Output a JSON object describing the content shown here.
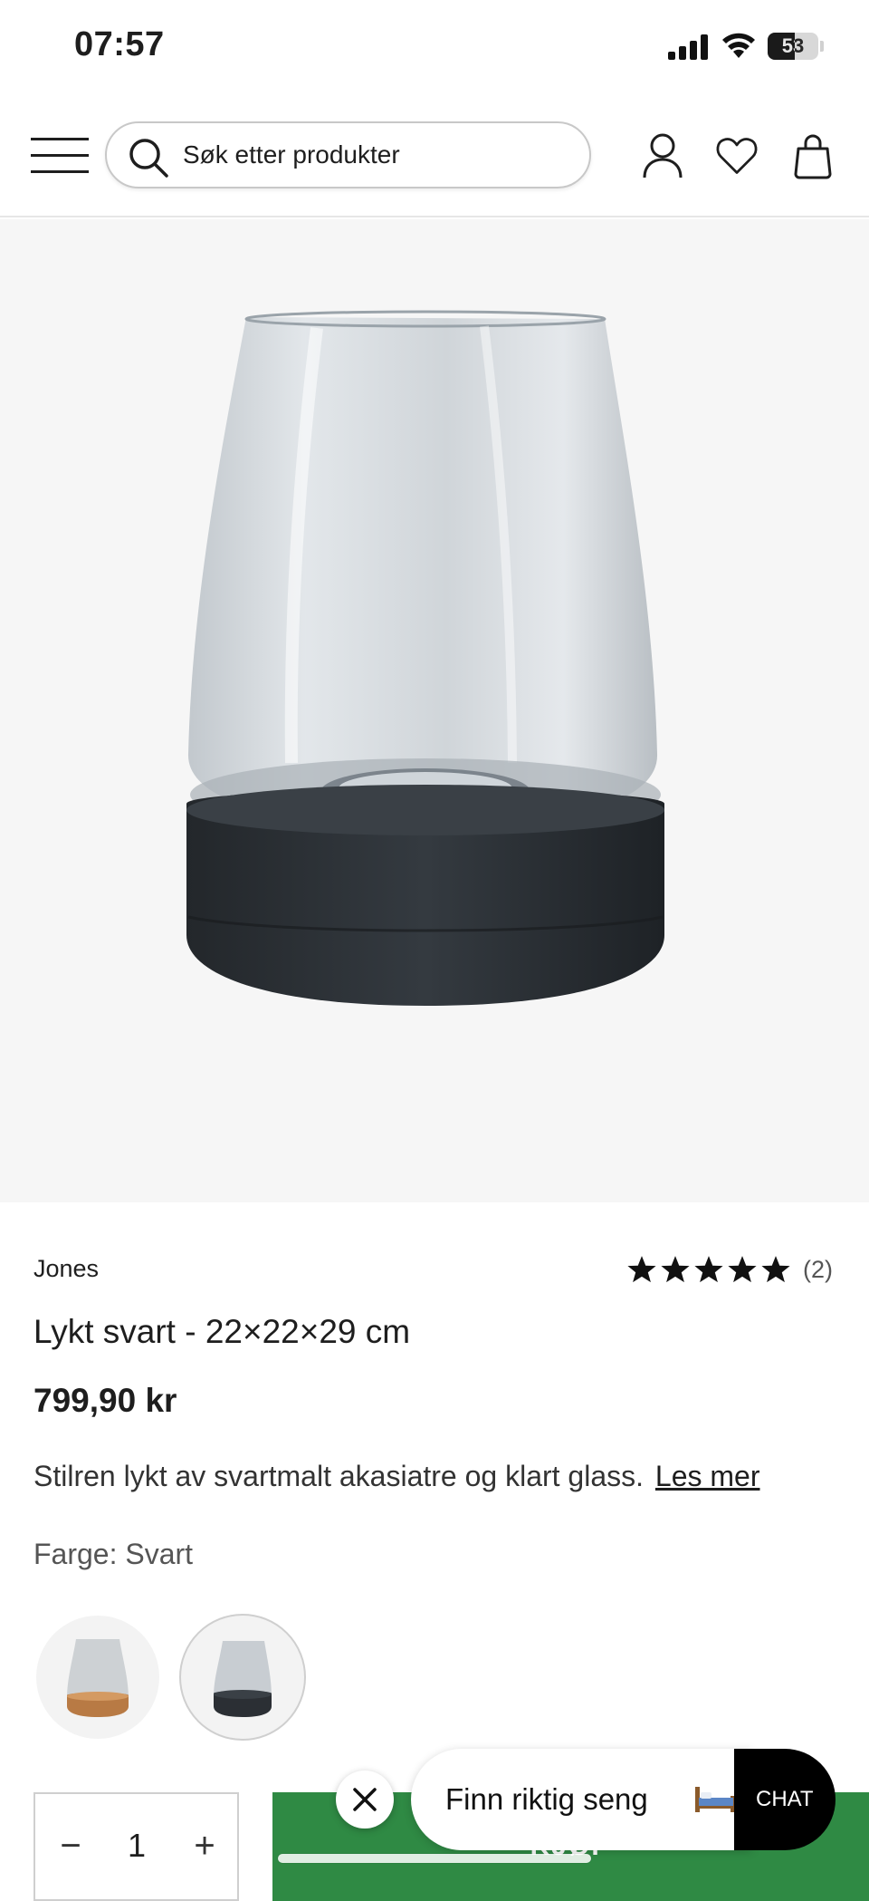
{
  "status_bar": {
    "time": "07:57",
    "battery_level": "53",
    "battery_fraction": 0.53
  },
  "header": {
    "search": {
      "placeholder": "Søk etter produkter"
    },
    "icons": [
      "menu-icon",
      "search-icon",
      "account-icon",
      "heart-icon",
      "bag-icon"
    ]
  },
  "product": {
    "brand": "Jones",
    "rating": {
      "stars": 5,
      "count_label": "(2)"
    },
    "title": "Lykt svart - 22×22×29 cm",
    "price": "799,90 kr",
    "description": "Stilren lykt av svartmalt akasiatre og klart glass.",
    "read_more": "Les mer",
    "color_label": "Farge:",
    "color_value": "Svart",
    "swatches": [
      {
        "name": "natural-wood",
        "selected": false
      },
      {
        "name": "black",
        "selected": true
      }
    ]
  },
  "purchase": {
    "quantity": "1",
    "minus": "−",
    "plus": "+",
    "buy_label": "KJØP"
  },
  "chat": {
    "bubble_text": "Finn riktig seng",
    "button_label": "CHAT"
  },
  "colors": {
    "buy_green": "#2f8a44",
    "image_bg": "#f6f6f6",
    "base_black": "#2b2f34"
  }
}
